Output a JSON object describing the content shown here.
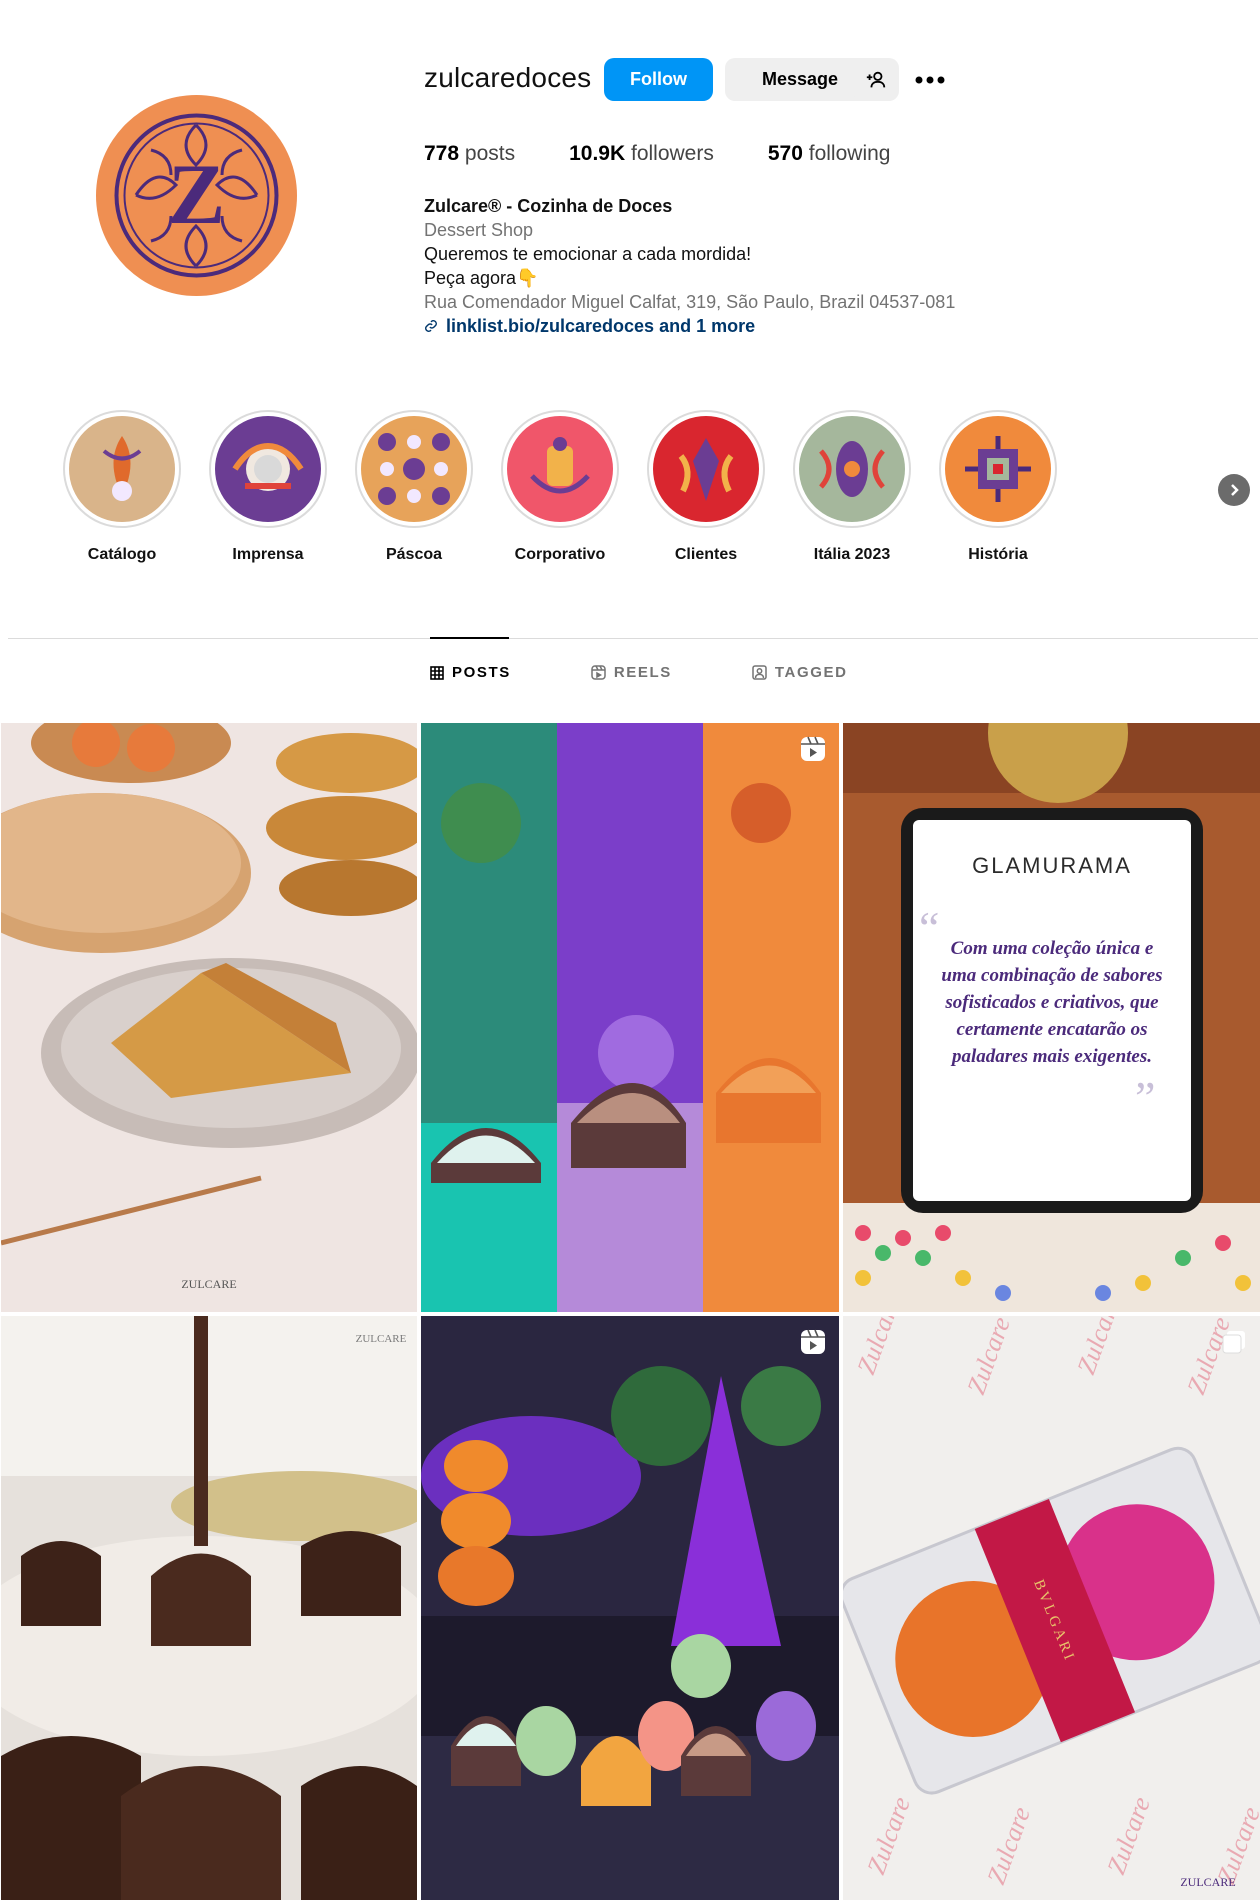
{
  "profile": {
    "username": "zulcaredoces",
    "follow_label": "Follow",
    "message_label": "Message",
    "stats": {
      "posts_count": "778",
      "posts_label": "posts",
      "followers_count": "10.9K",
      "followers_label": "followers",
      "following_count": "570",
      "following_label": "following"
    },
    "bio": {
      "name": "Zulcare® - Cozinha de Doces",
      "category": "Dessert Shop",
      "line1": "Queremos te emocionar a cada mordida!",
      "line2": "Peça agora👇",
      "address": "Rua Comendador Miguel Calfat, 319, São Paulo, Brazil 04537-081",
      "link": "linklist.bio/zulcaredoces and 1 more"
    },
    "avatar_letter": "Z",
    "brand_color": "#ef8f52",
    "brand_purple": "#4b2a7b"
  },
  "highlights": [
    {
      "label": "Catálogo",
      "bg": "#d9b48a"
    },
    {
      "label": "Imprensa",
      "bg": "#6b3d93"
    },
    {
      "label": "Páscoa",
      "bg": "#e7a35a"
    },
    {
      "label": "Corporativo",
      "bg": "#f0566a"
    },
    {
      "label": "Clientes",
      "bg": "#d9262f"
    },
    {
      "label": "Itália 2023",
      "bg": "#a5b79c"
    },
    {
      "label": "História",
      "bg": "#f08a3c"
    }
  ],
  "tabs": {
    "posts": "POSTS",
    "reels": "REELS",
    "tagged": "TAGGED"
  },
  "posts": {
    "p1_brand": "ZULCARE",
    "p3_title": "GLAMURAMA",
    "p3_quote": "Com uma coleção única e uma combinação de sabores sofisticados e criativos, que certamente encatarão os paladares mais exigentes.",
    "p4_brand": "ZULCARE",
    "p6_brand_box": "BVLGARI",
    "p6_footer": "ZULCARE"
  }
}
